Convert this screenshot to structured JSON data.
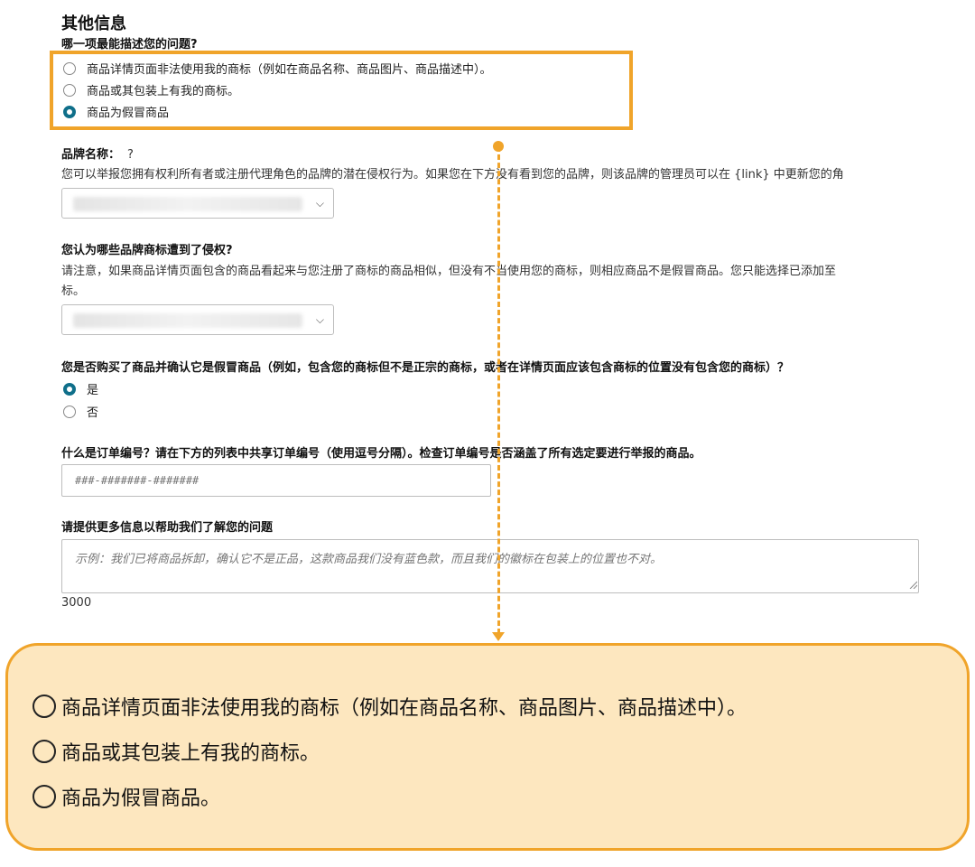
{
  "section": {
    "title": "其他信息"
  },
  "issue_question": {
    "label": "哪一项最能描述您的问题?",
    "options": [
      {
        "label": "商品详情页面非法使用我的商标（例如在商品名称、商品图片、商品描述中）。",
        "selected": false
      },
      {
        "label": "商品或其包装上有我的商标。",
        "selected": false
      },
      {
        "label": "商品为假冒商品",
        "selected": true
      }
    ]
  },
  "brand": {
    "label": "品牌名称：",
    "help_icon": "?",
    "help_text": "您可以举报您拥有权利所有者或注册代理角色的品牌的潜在侵权行为。如果您在下方没有看到您的品牌，则该品牌的管理员可以在 {link} 中更新您的角",
    "select_icon": "chevron-down-icon"
  },
  "trademark": {
    "label": "您认为哪些品牌商标遭到了侵权?",
    "help_text_line1": "请注意，如果商品详情页面包含的商品看起来与您注册了商标的商品相似，但没有不当使用您的商标，则相应商品不是假冒商品。您只能选择已添加至",
    "help_text_line2": "标。",
    "select_icon": "chevron-down-icon"
  },
  "purchase": {
    "label": "您是否购买了商品并确认它是假冒商品（例如，包含您的商标但不是正宗的商标，或者在详情页面应该包含商标的位置没有包含您的商标）？",
    "options": [
      {
        "label": "是",
        "selected": true
      },
      {
        "label": "否",
        "selected": false
      }
    ]
  },
  "order": {
    "label": "什么是订单编号？请在下方的列表中共享订单编号（使用逗号分隔）。检查订单编号是否涵盖了所有选定要进行举报的商品。",
    "placeholder": "###-#######-#######"
  },
  "details": {
    "label": "请提供更多信息以帮助我们了解您的问题",
    "placeholder": "示例：我们已将商品拆卸，确认它不是正品，这款商品我们没有蓝色款，而且我们的徽标在包装上的位置也不对。",
    "counter": "3000"
  },
  "callout": {
    "lines": [
      "商品详情页面非法使用我的商标（例如在商品名称、商品图片、商品描述中）。",
      "商品或其包装上有我的商标。",
      "商品为假冒商品。"
    ]
  },
  "colors": {
    "accent": "#f0a42a",
    "callout_bg": "#fde7bf",
    "radio_selected": "#0f6f8a"
  }
}
